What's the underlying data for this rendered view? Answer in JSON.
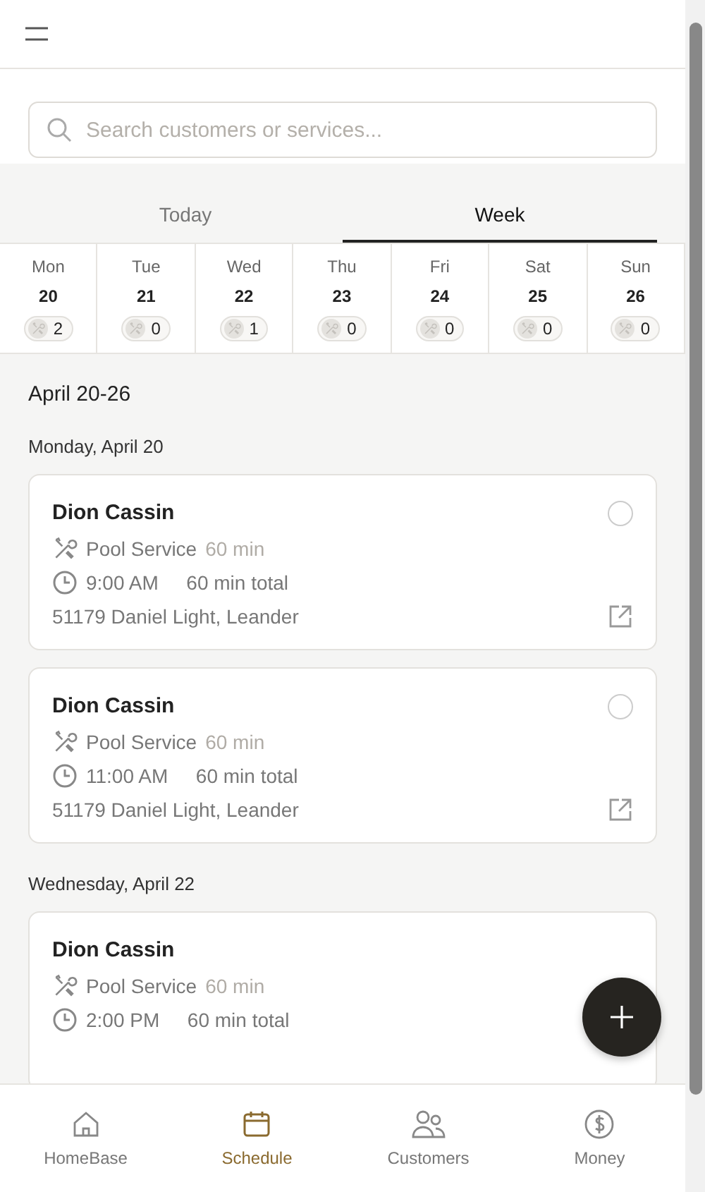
{
  "search": {
    "placeholder": "Search customers or services..."
  },
  "tabs": [
    {
      "label": "Today",
      "selected": false
    },
    {
      "label": "Week",
      "selected": true
    }
  ],
  "days": [
    {
      "weekday": "Mon",
      "date": "20",
      "count": "2"
    },
    {
      "weekday": "Tue",
      "date": "21",
      "count": "0"
    },
    {
      "weekday": "Wed",
      "date": "22",
      "count": "1"
    },
    {
      "weekday": "Thu",
      "date": "23",
      "count": "0"
    },
    {
      "weekday": "Fri",
      "date": "24",
      "count": "0"
    },
    {
      "weekday": "Sat",
      "date": "25",
      "count": "0"
    },
    {
      "weekday": "Sun",
      "date": "26",
      "count": "0"
    }
  ],
  "range_title": "April 20-26",
  "groups": [
    {
      "heading": "Monday, April 20",
      "jobs": [
        {
          "customer": "Dion Cassin",
          "service": "Pool Service",
          "duration": "60 min",
          "time": "9:00 AM",
          "total": "60 min total",
          "address": "51179 Daniel Light, Leander",
          "checked": false
        },
        {
          "customer": "Dion Cassin",
          "service": "Pool Service",
          "duration": "60 min",
          "time": "11:00 AM",
          "total": "60 min total",
          "address": "51179 Daniel Light, Leander",
          "checked": false
        }
      ]
    },
    {
      "heading": "Wednesday, April 22",
      "jobs": [
        {
          "customer": "Dion Cassin",
          "service": "Pool Service",
          "duration": "60 min",
          "time": "2:00 PM",
          "total": "60 min total"
        }
      ]
    }
  ],
  "nav": [
    {
      "label": "HomeBase",
      "kind": "home",
      "selected": false
    },
    {
      "label": "Schedule",
      "kind": "calendar",
      "selected": true
    },
    {
      "label": "Customers",
      "kind": "people",
      "selected": false
    },
    {
      "label": "Money",
      "kind": "dollar",
      "selected": false
    }
  ]
}
